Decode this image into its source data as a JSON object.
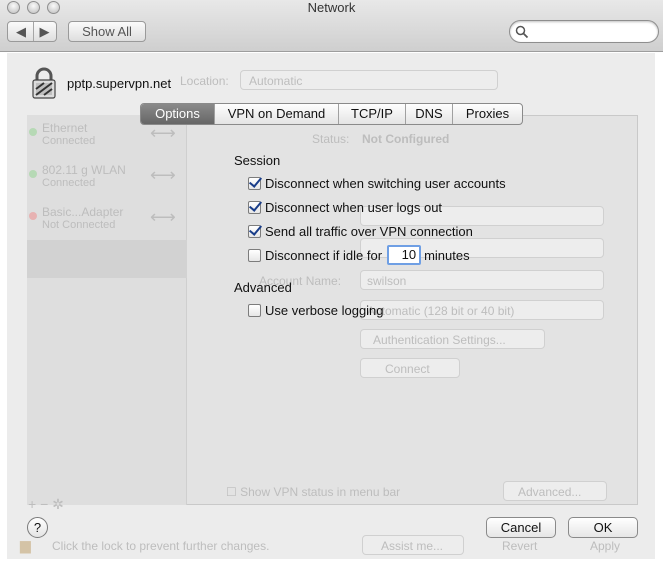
{
  "window": {
    "title": "Network"
  },
  "toolbar": {
    "show_all_label": "Show All",
    "search_placeholder": ""
  },
  "sheet": {
    "connection_name": "pptp.supervpn.net",
    "tabs": [
      {
        "label": "Options",
        "active": true
      },
      {
        "label": "VPN on Demand",
        "active": false
      },
      {
        "label": "TCP/IP",
        "active": false
      },
      {
        "label": "DNS",
        "active": false
      },
      {
        "label": "Proxies",
        "active": false
      }
    ],
    "session": {
      "heading": "Session",
      "options": [
        {
          "label": "Disconnect when switching user accounts",
          "checked": true
        },
        {
          "label": "Disconnect when user logs out",
          "checked": true
        },
        {
          "label": "Send all traffic over VPN connection",
          "checked": true
        }
      ],
      "idle": {
        "label": "Disconnect if idle for",
        "checked": false,
        "value": "10",
        "unit": "minutes"
      }
    },
    "advanced": {
      "heading": "Advanced",
      "verbose_label": "Use verbose logging",
      "verbose_checked": false
    },
    "help_label": "?",
    "cancel_label": "Cancel",
    "ok_label": "OK"
  },
  "background": {
    "location_label": "Location:",
    "location_value": "Automatic",
    "services": [
      {
        "name": "Ethernet",
        "status": "Connected",
        "color": "#7cc07a"
      },
      {
        "name": "802.11 g WLAN",
        "status": "Connected",
        "color": "#7cc07a"
      },
      {
        "name": "Basic...Adapter",
        "status": "Not Connected",
        "color": "#e08a8a"
      }
    ],
    "status_label": "Status:",
    "status_value": "Not Configured",
    "account_name_label": "Account Name:",
    "account_name_value": "swilson",
    "encryption_value": "Automatic (128 bit or 40 bit)",
    "auth_button": "Authentication Settings...",
    "connect_button": "Connect",
    "show_vpn_status": "Show VPN status in menu bar",
    "advanced_button": "Advanced...",
    "lock_text": "Click the lock to prevent further changes.",
    "assist_button": "Assist me...",
    "revert_button": "Revert",
    "apply_button": "Apply"
  },
  "colors": {
    "accent": "#6f9fe4",
    "checkmark": "#1a3e8a",
    "active_tab": "#6e6e6e"
  }
}
